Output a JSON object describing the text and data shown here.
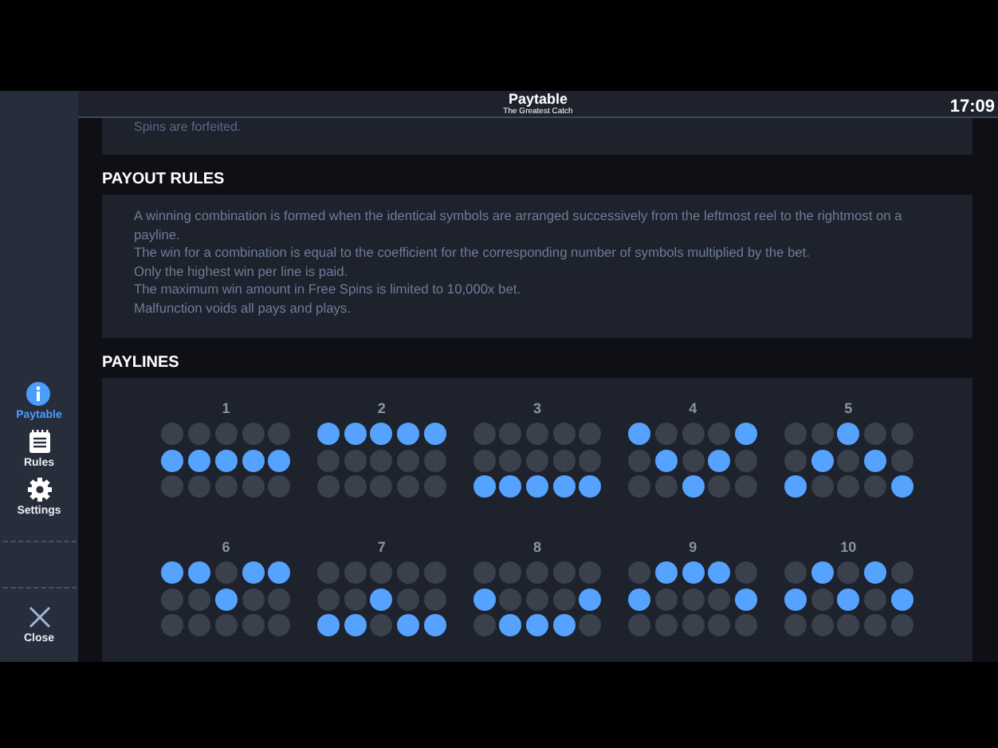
{
  "header": {
    "title": "Paytable",
    "subtitle": "The Greatest Catch",
    "time": "17:09"
  },
  "sidebar": {
    "items": [
      {
        "label": "Paytable",
        "kind": "info",
        "selected": true
      },
      {
        "label": "Rules",
        "kind": "rules",
        "selected": false
      },
      {
        "label": "Settings",
        "kind": "settings",
        "selected": false
      }
    ],
    "close": "Close"
  },
  "previous_section": {
    "text": "Spins are forfeited."
  },
  "payout_rules": {
    "heading": "PAYOUT RULES",
    "lines": [
      "A winning combination is formed when the identical symbols are arranged successively from the leftmost reel to the rightmost on a payline.",
      "The win for a combination is equal to the coefficient for the corresponding number of symbols multiplied by the bet.",
      "Only the highest win per line is paid.",
      "The maximum win amount in Free Spins is limited to 10,000x bet.",
      "Malfunction voids all pays and plays."
    ]
  },
  "paylines": {
    "heading": "PAYLINES",
    "lines": [
      {
        "number": "1",
        "rows": [
          [
            false,
            false,
            false,
            false,
            false
          ],
          [
            true,
            true,
            true,
            true,
            true
          ],
          [
            false,
            false,
            false,
            false,
            false
          ]
        ]
      },
      {
        "number": "2",
        "rows": [
          [
            true,
            true,
            true,
            true,
            true
          ],
          [
            false,
            false,
            false,
            false,
            false
          ],
          [
            false,
            false,
            false,
            false,
            false
          ]
        ]
      },
      {
        "number": "3",
        "rows": [
          [
            false,
            false,
            false,
            false,
            false
          ],
          [
            false,
            false,
            false,
            false,
            false
          ],
          [
            true,
            true,
            true,
            true,
            true
          ]
        ]
      },
      {
        "number": "4",
        "rows": [
          [
            true,
            false,
            false,
            false,
            true
          ],
          [
            false,
            true,
            false,
            true,
            false
          ],
          [
            false,
            false,
            true,
            false,
            false
          ]
        ]
      },
      {
        "number": "5",
        "rows": [
          [
            false,
            false,
            true,
            false,
            false
          ],
          [
            false,
            true,
            false,
            true,
            false
          ],
          [
            true,
            false,
            false,
            false,
            true
          ]
        ]
      },
      {
        "number": "6",
        "rows": [
          [
            true,
            true,
            false,
            true,
            true
          ],
          [
            false,
            false,
            true,
            false,
            false
          ],
          [
            false,
            false,
            false,
            false,
            false
          ]
        ]
      },
      {
        "number": "7",
        "rows": [
          [
            false,
            false,
            false,
            false,
            false
          ],
          [
            false,
            false,
            true,
            false,
            false
          ],
          [
            true,
            true,
            false,
            true,
            true
          ]
        ]
      },
      {
        "number": "8",
        "rows": [
          [
            false,
            false,
            false,
            false,
            false
          ],
          [
            true,
            false,
            false,
            false,
            true
          ],
          [
            false,
            true,
            true,
            true,
            false
          ]
        ]
      },
      {
        "number": "9",
        "rows": [
          [
            false,
            true,
            true,
            true,
            false
          ],
          [
            true,
            false,
            false,
            false,
            true
          ],
          [
            false,
            false,
            false,
            false,
            false
          ]
        ]
      },
      {
        "number": "10",
        "rows": [
          [
            false,
            true,
            false,
            true,
            false
          ],
          [
            true,
            false,
            true,
            false,
            true
          ],
          [
            false,
            false,
            false,
            false,
            false
          ]
        ]
      }
    ]
  }
}
